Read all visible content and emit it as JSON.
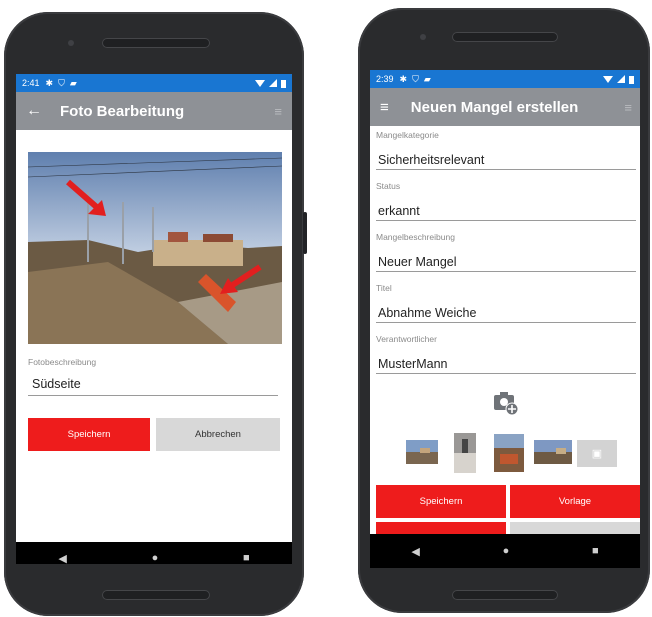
{
  "left_screen": {
    "status": {
      "time": "2:41"
    },
    "appbar": {
      "back_icon": "arrow-left-icon",
      "title": "Foto Bearbeitung",
      "menu_icon": "hamburger-icon"
    },
    "photo": {
      "description": "construction site photo with two red arrows"
    },
    "form": {
      "label": "Fotobeschreibung",
      "value": "Südseite"
    },
    "buttons": {
      "save": "Speichern",
      "cancel": "Abbrechen"
    }
  },
  "right_screen": {
    "status": {
      "time": "2:39"
    },
    "appbar": {
      "menu_icon": "hamburger-icon",
      "title": "Neuen Mangel erstellen",
      "right_icon": "hamburger-icon"
    },
    "fields": [
      {
        "label": "Mangelkategorie",
        "value": "Sicherheitsrelevant"
      },
      {
        "label": "Status",
        "value": "erkannt"
      },
      {
        "label": "Mangelbeschreibung",
        "value": "Neuer Mangel"
      },
      {
        "label": "Titel",
        "value": "Abnahme Weiche"
      },
      {
        "label": "Verantwortlicher",
        "value": "MusterMann"
      }
    ],
    "add_photo_icon": "camera-add-icon",
    "buttons": {
      "save": "Speichern",
      "template": "Vorlage"
    }
  },
  "colors": {
    "statusbar": "#1976d2",
    "appbar": "#8e9196",
    "accent_red": "#ee1c1c",
    "button_grey": "#d8d8d8"
  }
}
